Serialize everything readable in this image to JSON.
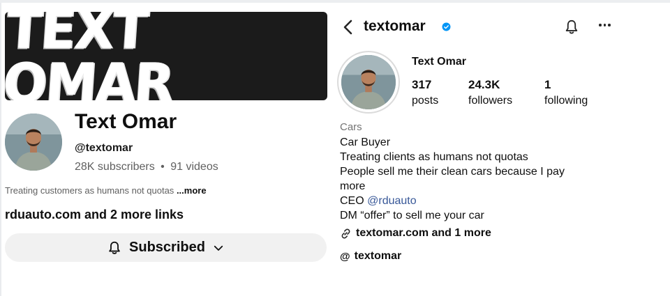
{
  "youtube": {
    "banner_text": "TEXT OMAR",
    "channel_name": "Text Omar",
    "handle": "@textomar",
    "subscribers": "28K subscribers",
    "separator": "•",
    "videos": "91 videos",
    "description": "Treating customers as humans not quotas",
    "more_label": "...more",
    "links": "rduauto.com and 2 more links",
    "subscribe_button": "Subscribed"
  },
  "instagram": {
    "username": "textomar",
    "display_name": "Text Omar",
    "stats": [
      {
        "value": "317",
        "label": "posts"
      },
      {
        "value": "24.3K",
        "label": "followers"
      },
      {
        "value": "1",
        "label": "following"
      }
    ],
    "category": "Cars",
    "bio": {
      "line1": "Car Buyer",
      "line2": "Treating clients as humans not quotas",
      "line3": "People sell me their clean cars because I pay",
      "line4": "more",
      "ceo_prefix": "CEO ",
      "ceo_mention": "@rduauto",
      "line6": "DM “offer” to sell me your car"
    },
    "link": "textomar.com and 1 more",
    "threads_handle": "textomar",
    "threads_glyph": "@"
  },
  "colors": {
    "banner_bg": "#1b1b1b",
    "verified_blue": "#0095f6",
    "mention_blue": "#385898",
    "subscribe_bg": "#f1f1f1",
    "muted_text": "#606060"
  },
  "icons": [
    "chevron-left-icon",
    "verified-badge-icon",
    "bell-icon",
    "more-options-icon",
    "link-icon",
    "threads-icon",
    "chevron-down-icon"
  ]
}
